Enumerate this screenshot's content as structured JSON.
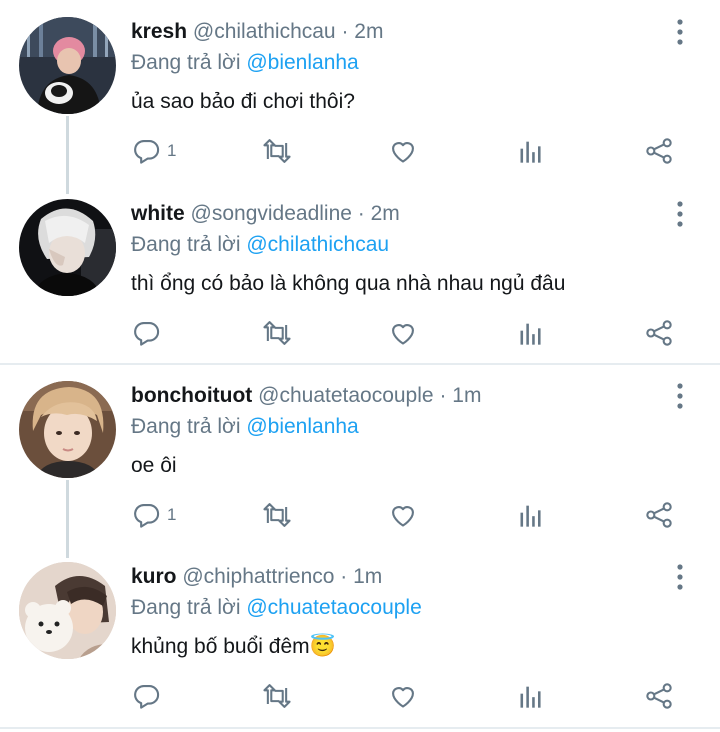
{
  "tweets": [
    {
      "name": "kresh",
      "handle": "@chilathichcau",
      "time": "· 2m",
      "reply_prefix": "Đang trả lời",
      "reply_to": "@bienlanha",
      "text": "ủa sao bảo đi chơi thôi?",
      "reply_count": "1"
    },
    {
      "name": "white",
      "handle": "@songvideadline",
      "time": "· 2m",
      "reply_prefix": "Đang trả lời",
      "reply_to": "@chilathichcau",
      "text": "thì ổng có bảo là không qua nhà nhau ngủ đâu",
      "reply_count": ""
    },
    {
      "name": "bonchoituot",
      "handle": "@chuatetaocouple",
      "time": "· 1m",
      "reply_prefix": "Đang trả lời",
      "reply_to": "@bienlanha",
      "text": "oe ôi",
      "reply_count": "1"
    },
    {
      "name": "kuro",
      "handle": "@chiphattrienco",
      "time": "· 1m",
      "reply_prefix": "Đang trả lời",
      "reply_to": "@chuatetaocouple",
      "text": "khủng bố buổi đêm😇",
      "reply_count": ""
    }
  ],
  "colors": {
    "accent": "#1da1f2",
    "secondary_text": "#657786",
    "icon": "#657786"
  },
  "icons": [
    "more-vertical-icon",
    "reply-icon",
    "retweet-icon",
    "like-icon",
    "analytics-icon",
    "share-icon"
  ]
}
